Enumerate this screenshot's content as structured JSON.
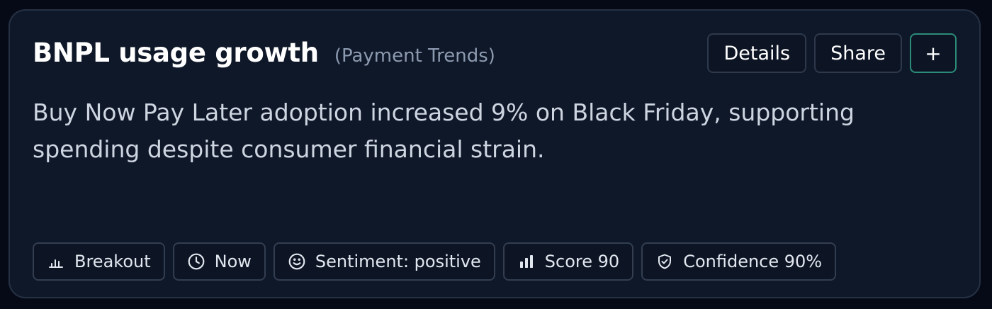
{
  "card": {
    "title": "BNPL usage growth",
    "category": "(Payment Trends)",
    "description": "Buy Now Pay Later adoption increased 9% on Black Friday, supporting spending despite consumer financial strain."
  },
  "actions": {
    "details_label": "Details",
    "share_label": "Share",
    "add_label": "+"
  },
  "chips": {
    "type": {
      "label": "Breakout",
      "icon": "bar-chart-small-icon"
    },
    "time": {
      "label": "Now",
      "icon": "clock-icon"
    },
    "sentiment": {
      "label": "Sentiment: positive",
      "icon": "smiley-icon"
    },
    "score": {
      "label": "Score 90",
      "icon": "bar-chart-icon"
    },
    "confidence": {
      "label": "Confidence 90%",
      "icon": "shield-check-icon"
    }
  },
  "colors": {
    "background": "#050a16",
    "card_background": "#0f1829",
    "accent_border": "#2b8c78",
    "muted_text": "#8c9ab0"
  }
}
